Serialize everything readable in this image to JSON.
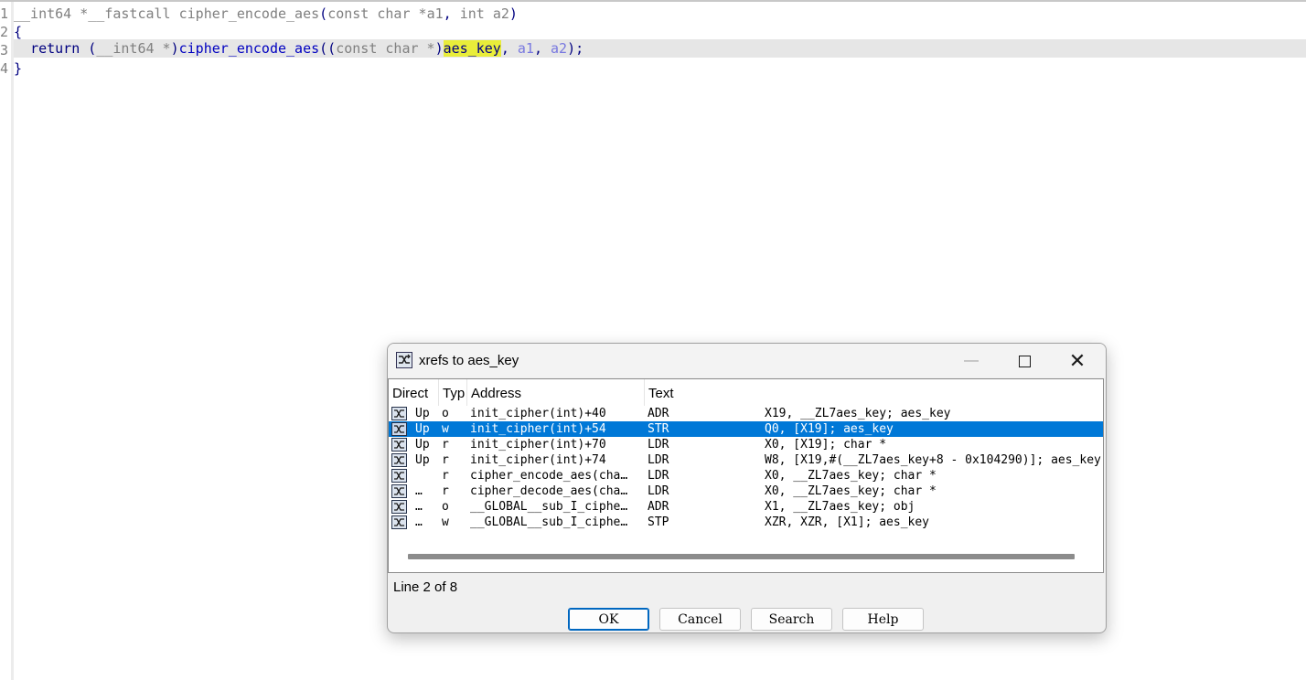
{
  "editor": {
    "line_numbers": [
      "1",
      "2",
      "3",
      "4"
    ],
    "line1": {
      "ret_type": "__int64 *__fastcall ",
      "func": "cipher_encode_aes",
      "open": "(",
      "p1_type": "const char *",
      "p1": "a1",
      "sep": ", ",
      "p2_type": "int ",
      "p2": "a2",
      "close": ")"
    },
    "line2": "{",
    "line3": {
      "indent": "  ",
      "kw": "return",
      "sp": " ",
      "cast_open": "(",
      "cast_type": "__int64 *",
      "cast_close": ")",
      "call": "cipher_encode_aes",
      "call_open": "((",
      "arg_type": "const char *",
      "arg_close": ")",
      "highlighted": "aes_key",
      "c1": ", ",
      "a1": "a1",
      "c2": ", ",
      "a2": "a2",
      "end": ");"
    },
    "line4": "}"
  },
  "dialog": {
    "title": "xrefs to aes_key",
    "icon": "xref-icon",
    "window_buttons": {
      "minimize": "—",
      "close": "✕"
    },
    "columns": [
      "Direct",
      "Typ",
      "Address",
      "Text"
    ],
    "rows": [
      {
        "direction": "Up",
        "type": "o",
        "address": "init_cipher(int)+40",
        "mnemonic": "ADR",
        "operands": "X19, __ZL7aes_key; aes_key"
      },
      {
        "direction": "Up",
        "type": "w",
        "address": "init_cipher(int)+54",
        "mnemonic": "STR",
        "operands": "Q0, [X19]; aes_key"
      },
      {
        "direction": "Up",
        "type": "r",
        "address": "init_cipher(int)+70",
        "mnemonic": "LDR",
        "operands": "X0, [X19]; char *"
      },
      {
        "direction": "Up",
        "type": "r",
        "address": "init_cipher(int)+74",
        "mnemonic": "LDR",
        "operands": "W8, [X19,#(__ZL7aes_key+8 - 0x104290)]; aes_key"
      },
      {
        "direction": "",
        "type": "r",
        "address": "cipher_encode_aes(cha…",
        "mnemonic": "LDR",
        "operands": "X0, __ZL7aes_key; char *"
      },
      {
        "direction": "…",
        "type": "r",
        "address": "cipher_decode_aes(cha…",
        "mnemonic": "LDR",
        "operands": "X0, __ZL7aes_key; char *"
      },
      {
        "direction": "…",
        "type": "o",
        "address": "__GLOBAL__sub_I_ciphe…",
        "mnemonic": "ADR",
        "operands": "X1, __ZL7aes_key; obj"
      },
      {
        "direction": "…",
        "type": "w",
        "address": "__GLOBAL__sub_I_ciphe…",
        "mnemonic": "STP",
        "operands": "XZR, XZR, [X1]; aes_key"
      }
    ],
    "selected_row": 1,
    "status": "Line 2 of 8",
    "buttons": {
      "ok": "OK",
      "cancel": "Cancel",
      "search": "Search",
      "help": "Help"
    }
  },
  "colors": {
    "selection": "#0078d7",
    "highlight": "#e9ed3a",
    "current_line": "#e6e6e6"
  }
}
